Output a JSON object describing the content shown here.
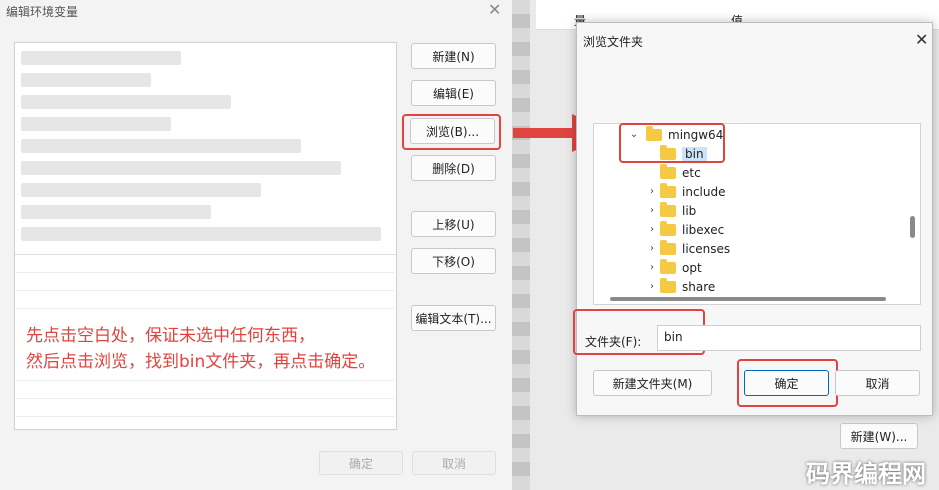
{
  "left_dialog": {
    "title": "编辑环境变量",
    "buttons": {
      "new": "新建(N)",
      "edit": "编辑(E)",
      "browse": "浏览(B)...",
      "delete": "删除(D)",
      "move_up": "上移(U)",
      "move_down": "下移(O)",
      "edit_text": "编辑文本(T)...",
      "ok": "确定",
      "cancel": "取消"
    },
    "annotation": [
      "先点击空白处，保证未选中任何东西，",
      "然后点击浏览，找到bin文件夹，再点击确定。"
    ]
  },
  "background_window": {
    "header_col1": "量",
    "header_col2": "值",
    "new_button": "新建(W)..."
  },
  "browse_dialog": {
    "title": "浏览文件夹",
    "tree": {
      "root": "mingw64",
      "selected": "bin",
      "children": [
        "etc",
        "include",
        "lib",
        "libexec",
        "licenses",
        "opt",
        "share"
      ]
    },
    "folder_label": "文件夹(F):",
    "folder_value": "bin",
    "buttons": {
      "new_folder": "新建文件夹(M)",
      "ok": "确定",
      "cancel": "取消"
    }
  },
  "watermark": "码界编程网",
  "colors": {
    "annotation_red": "#e0443e",
    "selection_blue": "#cce4f7",
    "folder_yellow": "#f6c945"
  }
}
